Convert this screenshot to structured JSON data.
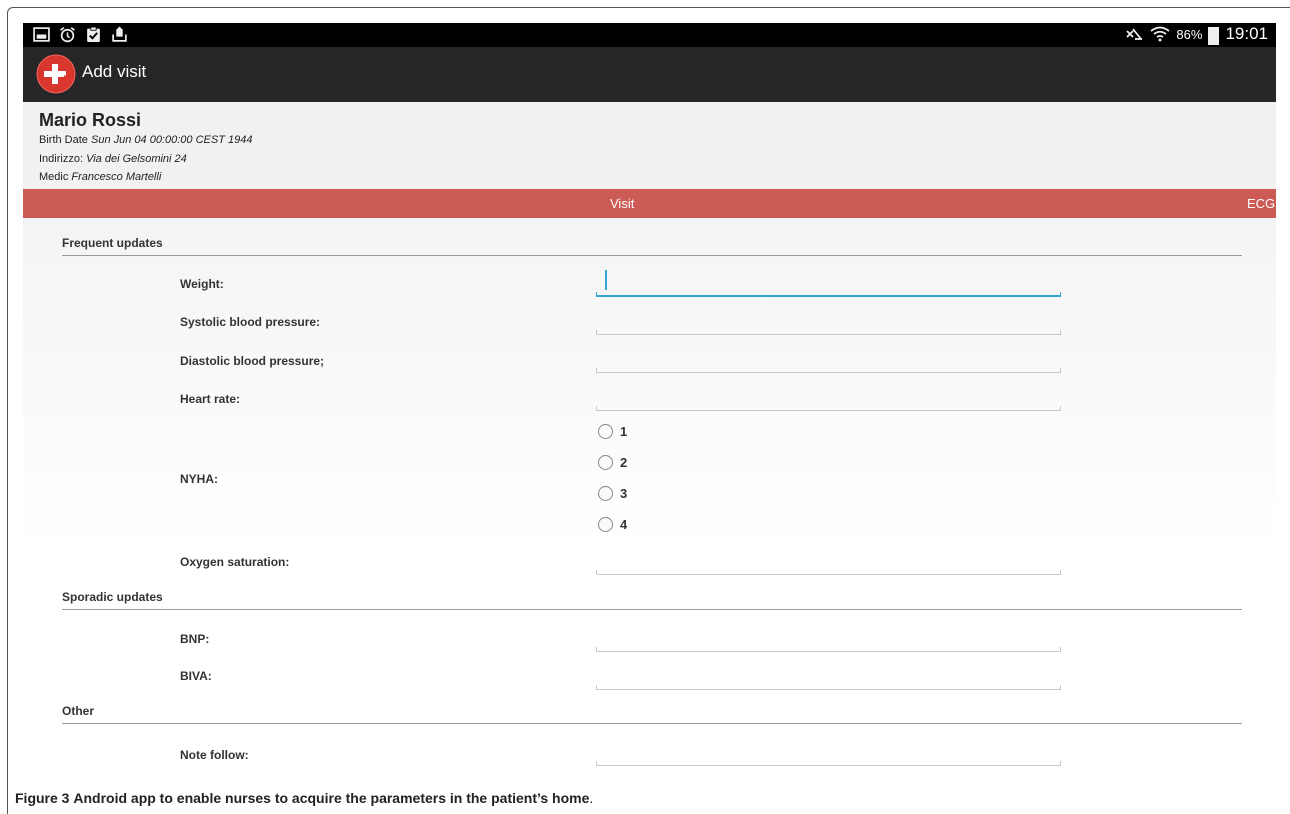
{
  "status_bar": {
    "battery": "86%",
    "time": "19:01",
    "left_icons": [
      "gallery-icon",
      "alarm-icon",
      "clipboard-check-icon",
      "upload-icon"
    ],
    "right_icons": [
      "mute-icon",
      "wifi-icon",
      "battery-icon"
    ]
  },
  "app_bar": {
    "title": "Add visit",
    "logo_icon": "medical-cross-icon"
  },
  "patient": {
    "name": "Mario Rossi",
    "birth_date_label": "Birth Date",
    "birth_date": "Sun Jun 04 00:00:00 CEST 1944",
    "address_label": "Indirizzo:",
    "address": "Via dei Gelsomini 24",
    "medic_label": "Medic",
    "medic": "Francesco Martelli"
  },
  "tabs": [
    {
      "label": "Visit",
      "selected": true
    },
    {
      "label": "ECG",
      "selected": false
    }
  ],
  "form": {
    "frequent_title": "Frequent updates",
    "weight_label": "Weight:",
    "systolic_label": "Systolic blood pressure:",
    "diastolic_label": "Diastolic blood pressure;",
    "heart_rate_label": "Heart rate:",
    "nyha_label": "NYHA:",
    "nyha_options": [
      "1",
      "2",
      "3",
      "4"
    ],
    "oxygen_label": "Oxygen saturation:",
    "sporadic_title": "Sporadic updates",
    "bnp_label": "BNP:",
    "biva_label": "BIVA:",
    "other_title": "Other",
    "note_label": "Note follow:"
  },
  "caption": {
    "figure": "Figure 3",
    "text": "Android app to enable nurses to acquire the parameters in the patient’s home",
    "period": "."
  },
  "colors": {
    "tab_bar": "#cc5a55",
    "action_bar": "#262626",
    "status_bar": "#000000",
    "focus": "#33a6d8"
  }
}
